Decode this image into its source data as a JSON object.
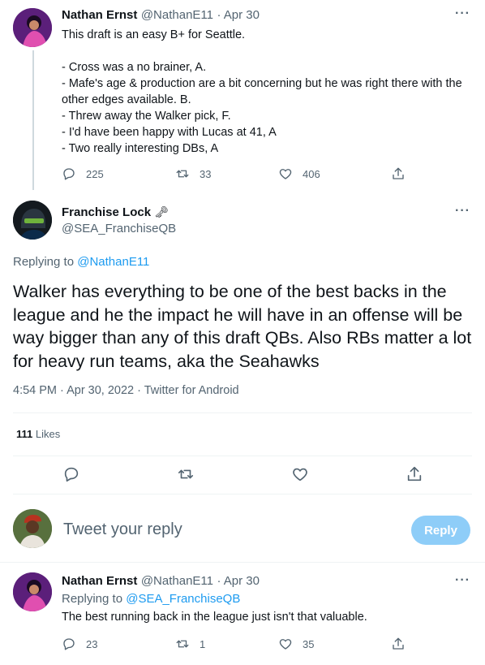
{
  "tweet1": {
    "author_name": "Nathan Ernst",
    "author_handle": "@NathanE11",
    "date": "· Apr 30",
    "text": "This draft is an easy B+ for Seattle.\n\n- Cross was a no brainer, A.\n- Mafe's age & production are a bit concerning but he was right there with the other edges available. B.\n- Threw away the Walker pick, F.\n- I'd have been happy with Lucas at 41, A\n- Two really interesting DBs, A",
    "replies": "225",
    "retweets": "33",
    "likes": "406"
  },
  "main_tweet": {
    "author_name": "Franchise Lock",
    "author_emoji": "🗝",
    "author_handle": "@SEA_FranchiseQB",
    "replying_label": "Replying to",
    "replying_to": "@NathanE11",
    "text": "Walker has everything to be one of the best backs in the league and he the impact he will have in an offense will be way bigger than any of this draft QBs. Also RBs matter a lot for heavy run teams, aka the Seahawks",
    "timestamp": "4:54 PM · Apr 30, 2022 · Twitter for Android",
    "likes_count": "111",
    "likes_label": "Likes"
  },
  "composer": {
    "placeholder": "Tweet your reply",
    "reply_button": "Reply"
  },
  "tweet3": {
    "author_name": "Nathan Ernst",
    "author_handle": "@NathanE11",
    "date": "· Apr 30",
    "replying_label": "Replying to",
    "replying_to": "@SEA_FranchiseQB",
    "text": "The best running back in the league just isn't that valuable.",
    "replies": "23",
    "retweets": "1",
    "likes": "35"
  },
  "colors": {
    "accent": "#1d9bf0",
    "reply_button_disabled": "#8ecdf8",
    "muted": "#536471"
  }
}
